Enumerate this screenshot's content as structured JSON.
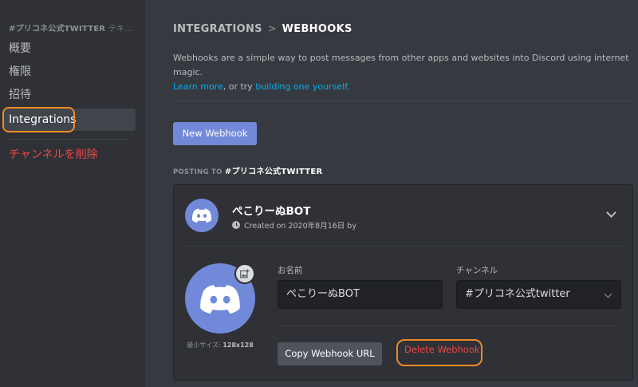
{
  "sidebar": {
    "header": "#プリコネ公式TWITTER",
    "header_suffix": "テキ...",
    "items": [
      {
        "label": "概要"
      },
      {
        "label": "権限"
      },
      {
        "label": "招待"
      },
      {
        "label": "Integrations",
        "selected": true
      }
    ],
    "delete_channel": "チャンネルを削除"
  },
  "breadcrumb": {
    "parent": "INTEGRATIONS",
    "separator": ">",
    "current": "WEBHOOKS"
  },
  "description": {
    "text": "Webhooks are a simple way to post messages from other apps and websites into Discord using internet magic.",
    "learn_more": "Learn more",
    "middle": ", or try",
    "build_link": "building one yourself."
  },
  "new_webhook_label": "New Webhook",
  "posting": {
    "prefix": "POSTING TO",
    "channel": "#プリコネ公式TWITTER"
  },
  "webhook": {
    "name": "ぺこりーぬBOT",
    "created_on": "Created on 2020年8月16日 by",
    "min_size_label": "最小サイズ:",
    "min_size_value": "128x128",
    "name_label": "お名前",
    "name_value": "ぺこりーぬBOT",
    "channel_label": "チャンネル",
    "channel_value": "#プリコネ公式twitter",
    "copy_url_label": "Copy Webhook URL",
    "delete_label": "Delete Webhook"
  },
  "colors": {
    "accent": "#7289da",
    "danger": "#f04747",
    "highlight": "#f08a24",
    "link": "#00b0f4"
  },
  "icons": {
    "avatar": "discord-logo-icon",
    "upload": "image-add-icon",
    "clock": "clock-icon",
    "expand": "chevron-down-icon"
  }
}
